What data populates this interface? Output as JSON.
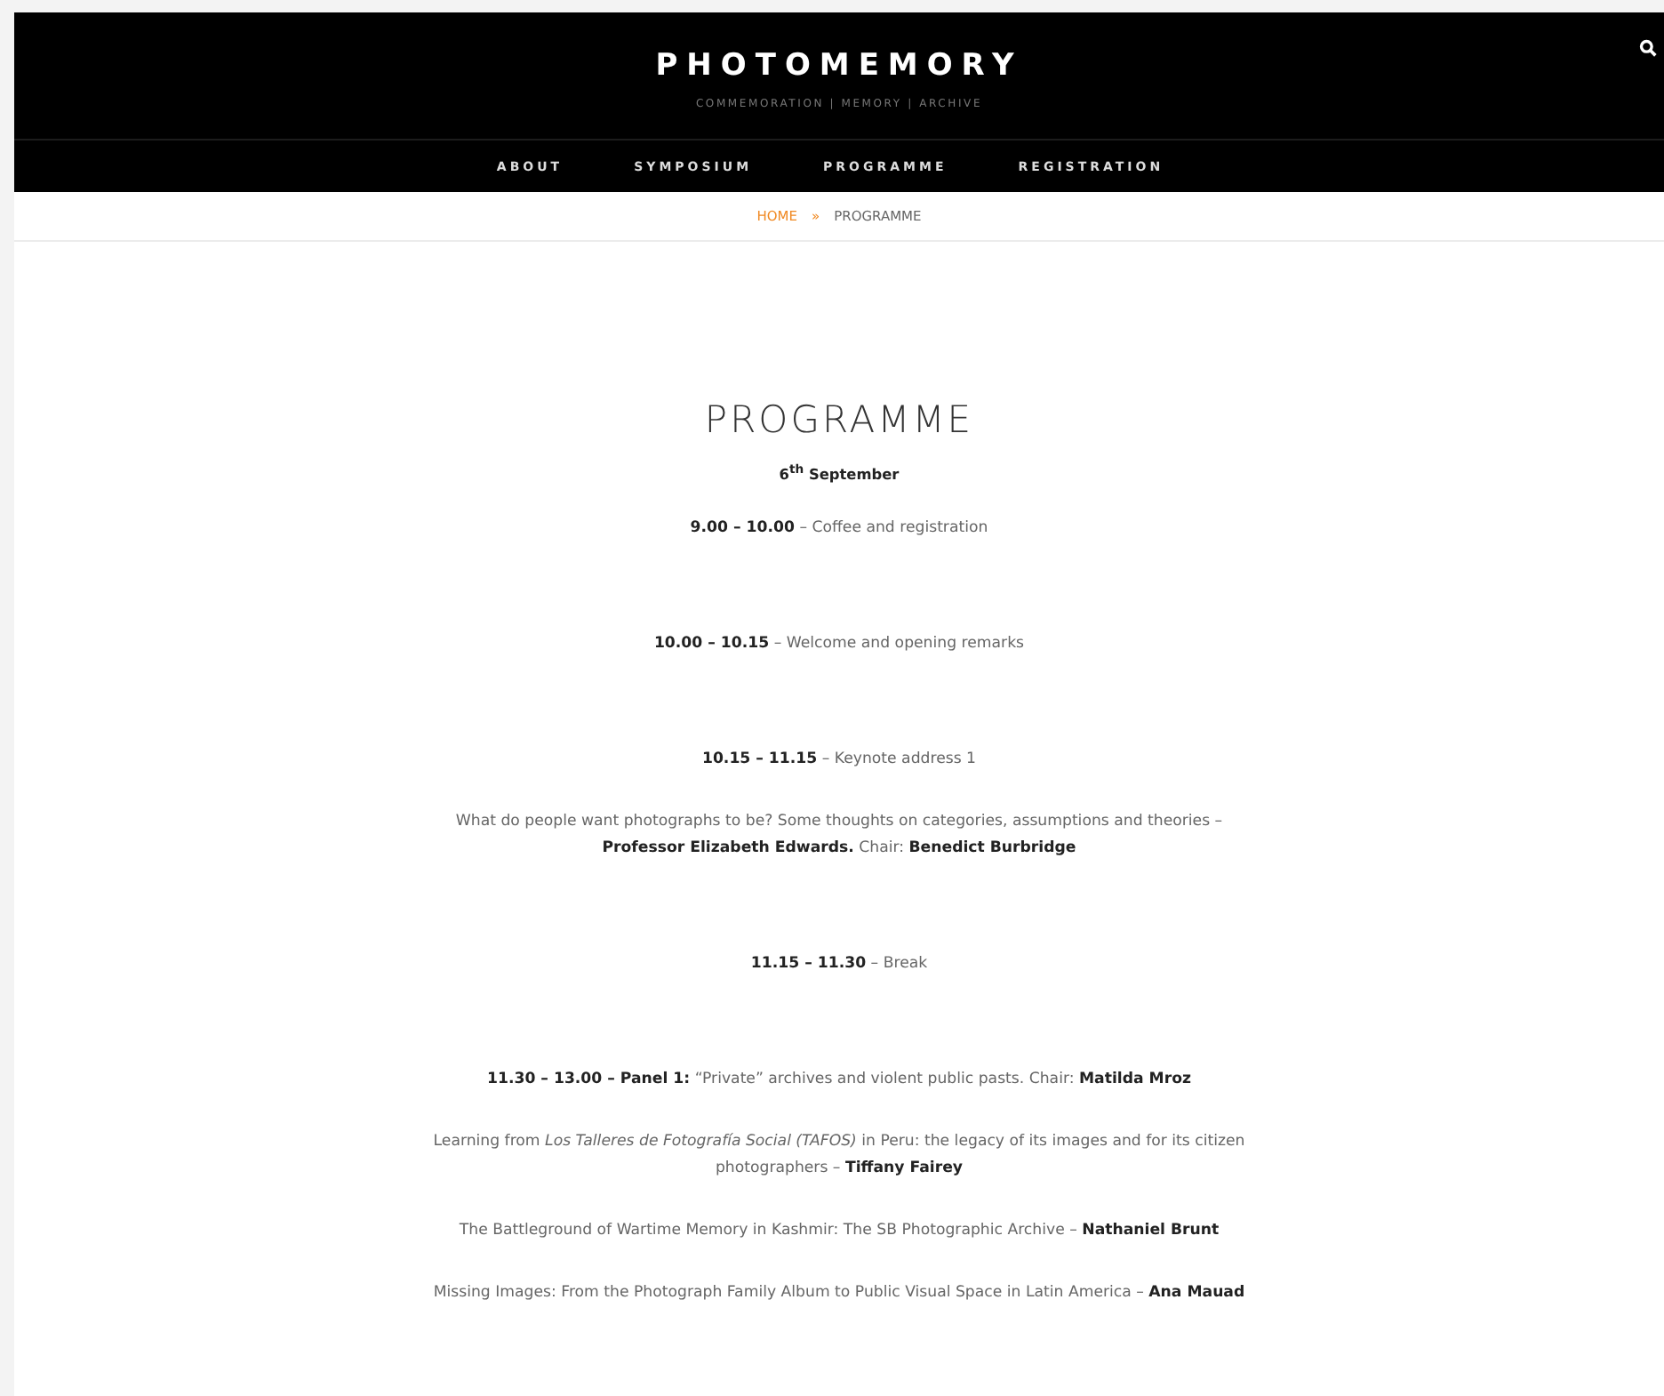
{
  "site": {
    "title": "PHOTOMEMORY",
    "tagline": "COMMEMORATION | MEMORY | ARCHIVE"
  },
  "nav": [
    {
      "label": "ABOUT"
    },
    {
      "label": "SYMPOSIUM"
    },
    {
      "label": "PROGRAMME"
    },
    {
      "label": "REGISTRATION"
    }
  ],
  "breadcrumb": {
    "home": "HOME",
    "separator": "»",
    "current": "PROGRAMME"
  },
  "page": {
    "heading": "PROGRAMME",
    "date": "6$^{th}$ September",
    "items": [
      {
        "kind": "slot",
        "text": "**9.00 – 10.00** – Coffee and registration"
      },
      {
        "kind": "slot",
        "text": "**10.00 – 10.15** – Welcome and opening remarks"
      },
      {
        "kind": "slot",
        "text": "**10.15 – 11.15** – Keynote address 1"
      },
      {
        "kind": "talk",
        "text": "What do people want photographs to be? Some thoughts on categories, assumptions and theories – **Professor Elizabeth Edwards.** Chair: **Benedict Burbridge**"
      },
      {
        "kind": "slot",
        "text": "**11.15 – 11.30** – Break"
      },
      {
        "kind": "slot",
        "text": "**11.30 – 13.00 – Panel 1:** “Private” archives and violent public pasts. Chair: **Matilda Mroz**"
      },
      {
        "kind": "talk",
        "text": "Learning from *Los Talleres de Fotografía Social (TAFOS)* in Peru: the legacy of its images and for its citizen photographers – **Tiffany Fairey**"
      },
      {
        "kind": "talk",
        "text": "The Battleground of Wartime Memory in Kashmir: The SB Photographic Archive – **Nathaniel Brunt**"
      },
      {
        "kind": "talk",
        "text": "Missing Images: From the Photograph Family Album to Public Visual Space in Latin America – **Ana Mauad**"
      }
    ]
  }
}
